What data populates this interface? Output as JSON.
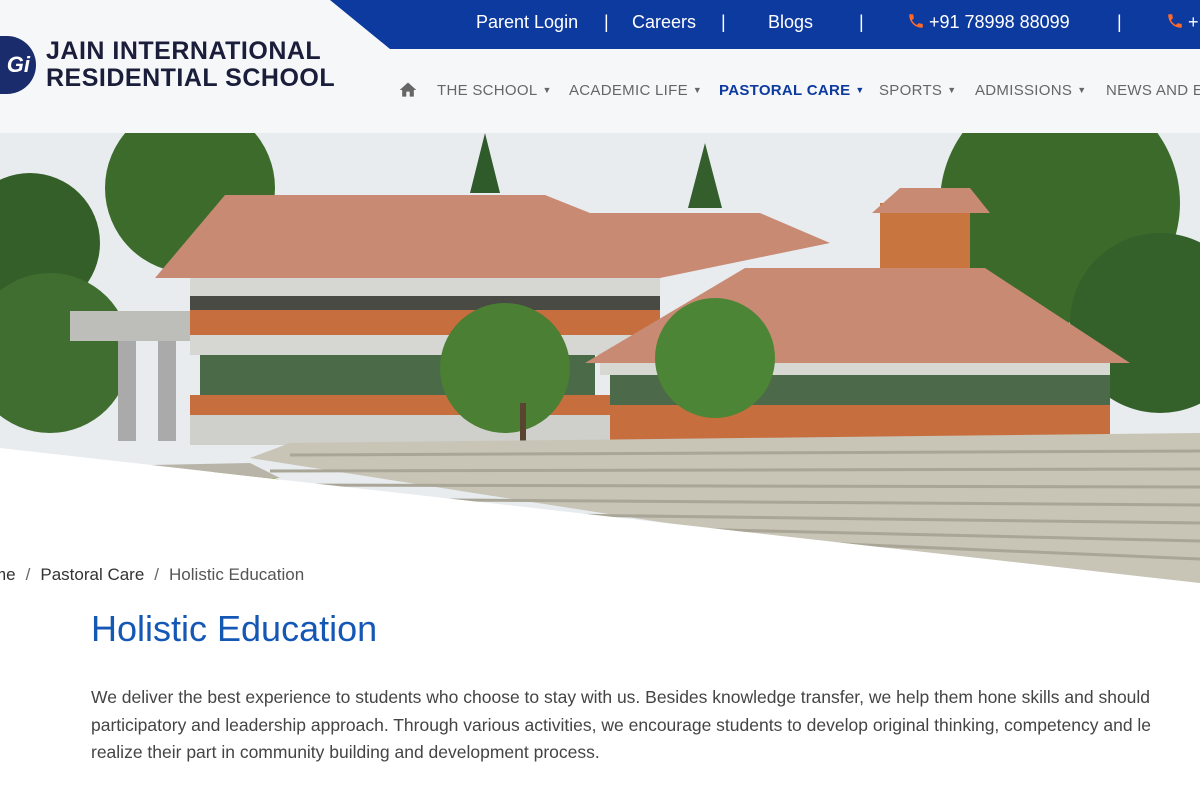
{
  "topbar": {
    "parent_login": "Parent Login",
    "careers": "Careers",
    "blogs": "Blogs",
    "phone1": "+91 78998 88099",
    "phone2": "+",
    "separator": "|",
    "icon": "phone-icon"
  },
  "logo": {
    "badge": "Gi",
    "line1": "JAIN INTERNATIONAL",
    "line2": "RESIDENTIAL SCHOOL"
  },
  "nav": {
    "home_icon": "home-icon",
    "items": [
      {
        "label": "THE SCHOOL"
      },
      {
        "label": "ACADEMIC LIFE"
      },
      {
        "label": "PASTORAL CARE",
        "active": true
      },
      {
        "label": "SPORTS"
      },
      {
        "label": "ADMISSIONS"
      },
      {
        "label": "NEWS AND E"
      }
    ]
  },
  "breadcrumb": {
    "home": "me",
    "section": "Pastoral Care",
    "current": "Holistic Education",
    "separator": "/"
  },
  "page": {
    "title": "Holistic Education",
    "intro_lines": [
      "We deliver the best experience to students who choose to stay with us. Besides knowledge transfer, we help them hone skills and should",
      "participatory and leadership approach. Through various activities, we encourage students to develop original thinking, competency and le",
      "realize their part in community building and development process."
    ]
  },
  "colors": {
    "topbar": "#0d3a9e",
    "active_nav": "#0d3a9e",
    "title": "#1457b5",
    "phone_icon": "#ff6a2b"
  }
}
